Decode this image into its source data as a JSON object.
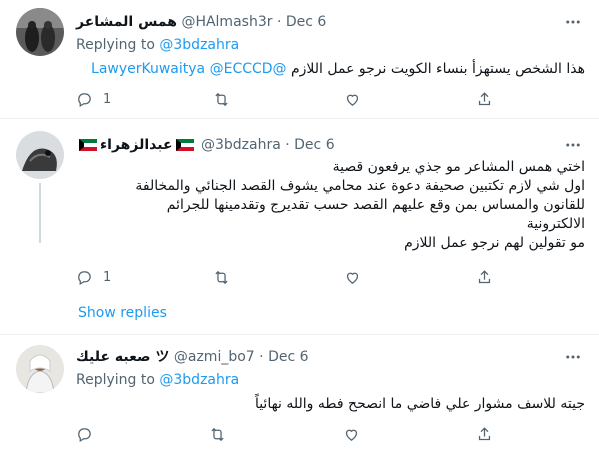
{
  "tweets": [
    {
      "name": "همس المشاعر",
      "handle": "@HAlmash3r",
      "sep": "·",
      "date": "Dec 6",
      "replying_prefix": "Replying to",
      "replying_to": "@3bdzahra",
      "body_lines": [
        "هذا الشخص يستهزأ بنساء الكويت نرجو عمل اللازم"
      ],
      "mentions": [
        "@ECCCD",
        "@LawyerKuwaitya"
      ],
      "reply_count": "1",
      "retweet_count": "",
      "like_count": ""
    },
    {
      "name": "عبدالزهراء",
      "handle": "@3bdzahra",
      "sep": "·",
      "date": "Dec 6",
      "body_lines": [
        "اختي همس المشاعر مو جذي يرفعون قصية",
        "اول شي لازم تكتبين صحيفة دعوة عند محامي يشوف القصد الجنائي والمخالفة",
        "للقانون والمساس بمن وقع عليهم القصد حسب تقديرج وتقدمينها للجرائم",
        "الالكترونية",
        "مو تقولين لهم نرجو عمل اللازم"
      ],
      "reply_count": "1",
      "retweet_count": "",
      "like_count": ""
    },
    {
      "name": "صعبه عليك ツ",
      "handle": "@azmi_bo7",
      "sep": "·",
      "date": "Dec 6",
      "replying_prefix": "Replying to",
      "replying_to": "@3bdzahra",
      "body_lines": [
        "جيته للاسف مشوار علي فاضي ما انصحح فطه والله نهائياً"
      ],
      "reply_count": "",
      "retweet_count": "",
      "like_count": ""
    }
  ],
  "show_replies": "Show replies",
  "colors": {
    "accent": "#1d9bf0",
    "muted": "#536471",
    "text": "#0f1419",
    "divider": "#eff3f4"
  },
  "icons": [
    "more-icon",
    "reply-icon",
    "retweet-icon",
    "like-icon",
    "share-icon",
    "kuwait-flag-icon"
  ]
}
